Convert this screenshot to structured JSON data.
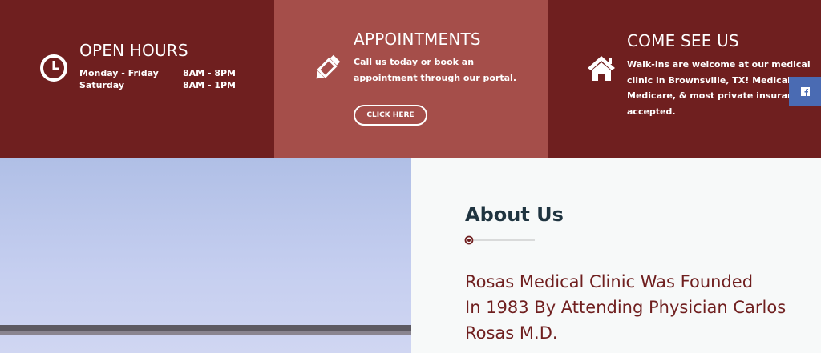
{
  "hours": {
    "title": "OPEN HOURS",
    "rows": [
      {
        "day": "Monday - Friday",
        "time": "8AM - 8PM"
      },
      {
        "day": "Saturday",
        "time": "8AM - 1PM"
      }
    ]
  },
  "appointments": {
    "title": "APPOINTMENTS",
    "text_line1": "Call us today or book an",
    "text_line2": "appointment through our portal.",
    "button_label": "CLICK HERE"
  },
  "visit": {
    "title": "COME SEE US",
    "lines": [
      "Walk-ins are welcome at our medical",
      "clinic in Brownsville, TX! Medicaid,",
      "Medicare, & most private insurances",
      "accepted."
    ]
  },
  "social": {
    "icon": "facebook-icon",
    "color": "#4a6bb3"
  },
  "about": {
    "title": "About Us",
    "line1": "Rosas Medical Clinic Was Founded",
    "line2": "In 1983 By Attending Physician Carlos",
    "line3": "Rosas M.D."
  },
  "colors": {
    "dark_red": "#6f1f1f",
    "light_red": "#a54e4a",
    "heading": "#1f3440"
  }
}
